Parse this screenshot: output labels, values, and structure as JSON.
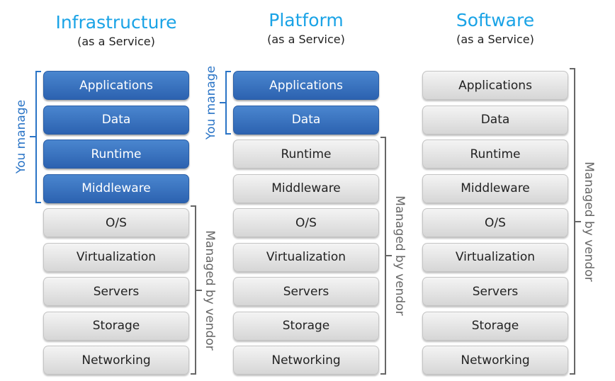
{
  "columns": [
    {
      "title": "Infrastructure",
      "subtitle": "(as a Service)",
      "you_manage_count": 4
    },
    {
      "title": "Platform",
      "subtitle": "(as a Service)",
      "you_manage_count": 2
    },
    {
      "title": "Software",
      "subtitle": "(as a Service)",
      "you_manage_count": 0
    }
  ],
  "layers": [
    "Applications",
    "Data",
    "Runtime",
    "Middleware",
    "O/S",
    "Virtualization",
    "Servers",
    "Storage",
    "Networking"
  ],
  "labels": {
    "you_manage": "You manage",
    "managed_by_vendor": "Managed by vendor"
  },
  "colors": {
    "title": "#1aa3e6",
    "you_manage": "#2c62b0",
    "vendor": "#d6d6d6",
    "you_manage_bracket": "#2a74c6",
    "vendor_bracket": "#666666"
  }
}
